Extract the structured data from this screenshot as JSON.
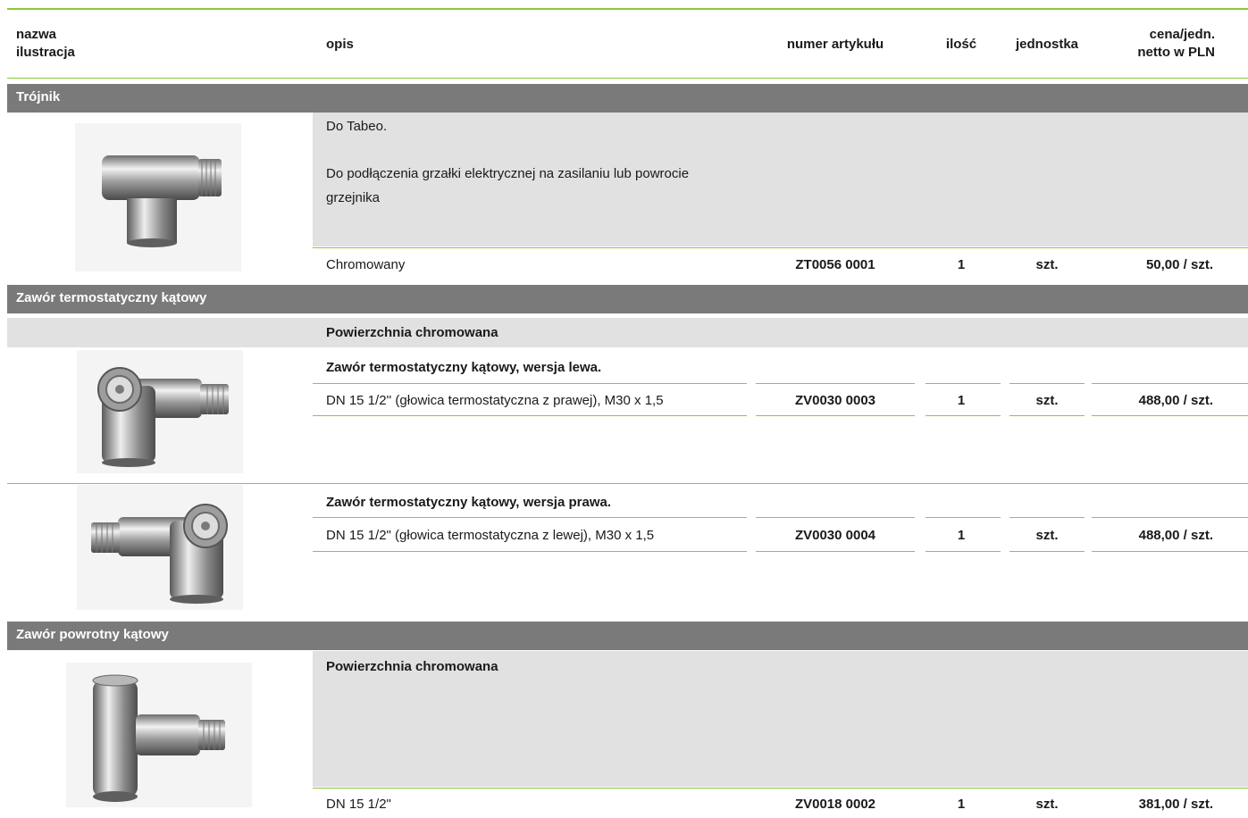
{
  "header": {
    "col_name_line1": "nazwa",
    "col_name_line2": "ilustracja",
    "col_desc": "opis",
    "col_article": "numer artykułu",
    "col_qty": "ilość",
    "col_unit": "jednostka",
    "col_price_line1": "cena/jedn.",
    "col_price_line2": "netto w PLN"
  },
  "sections": [
    {
      "title": "Trójnik",
      "desc_line1": "Do Tabeo.",
      "desc_line2": "Do podłączenia grzałki elektrycznej na zasilaniu lub powrocie",
      "desc_line3": "grzejnika",
      "row": {
        "desc": "Chromowany",
        "article": "ZT0056 0001",
        "qty": "1",
        "unit": "szt.",
        "price": "50,00 / szt."
      }
    },
    {
      "title": "Zawór termostatyczny kątowy",
      "surface": "Powierzchnia chromowana",
      "variant_left": {
        "title": "Zawór termostatyczny kątowy, wersja lewa.",
        "row": {
          "desc": "DN 15 1/2'' (głowica termostatyczna z prawej), M30 x 1,5",
          "article": "ZV0030 0003",
          "qty": "1",
          "unit": "szt.",
          "price": "488,00 / szt."
        }
      },
      "variant_right": {
        "title": "Zawór termostatyczny kątowy, wersja prawa.",
        "row": {
          "desc": "DN 15 1/2\" (głowica termostatyczna z lewej), M30 x 1,5",
          "article": "ZV0030 0004",
          "qty": "1",
          "unit": "szt.",
          "price": "488,00 / szt."
        }
      }
    },
    {
      "title": "Zawór powrotny kątowy",
      "surface": "Powierzchnia chromowana",
      "row": {
        "desc": "DN 15 1/2\"",
        "article": "ZV0018 0002",
        "qty": "1",
        "unit": "szt.",
        "price": "381,00 / szt."
      }
    }
  ]
}
